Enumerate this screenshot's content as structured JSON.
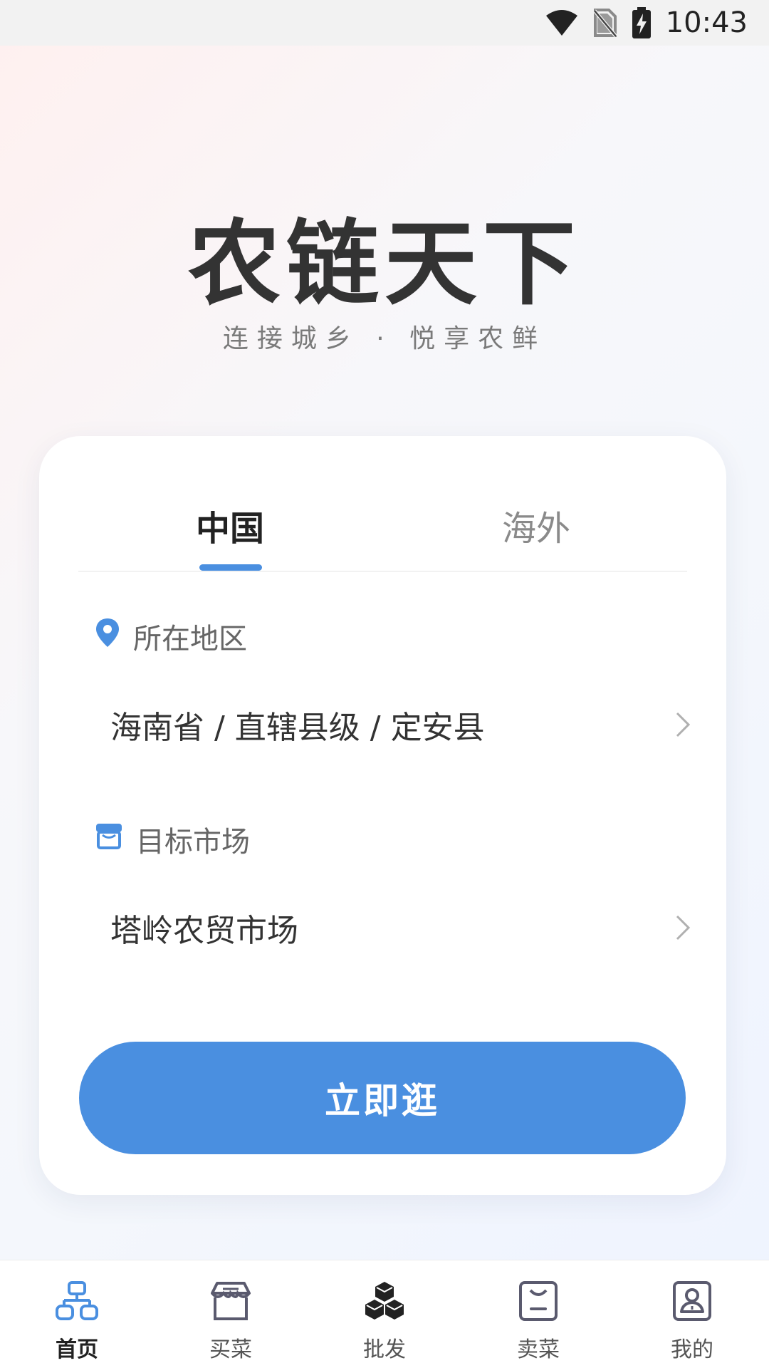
{
  "status_bar": {
    "time": "10:43",
    "icons": [
      "wifi-icon",
      "no-sim-icon",
      "battery-charging-icon"
    ]
  },
  "hero": {
    "title": "农链天下",
    "subtitle": "连接城乡 · 悦享农鲜"
  },
  "tabs": [
    {
      "label": "中国",
      "active": true
    },
    {
      "label": "海外",
      "active": false
    }
  ],
  "region": {
    "label": "所在地区",
    "icon": "location-pin-icon",
    "value": "海南省 / 直辖县级 / 定安县"
  },
  "market": {
    "label": "目标市场",
    "icon": "store-icon",
    "value": "塔岭农贸市场"
  },
  "action": {
    "label": "立即逛"
  },
  "bottom_nav": [
    {
      "label": "首页",
      "icon": "home-network-icon",
      "active": true
    },
    {
      "label": "买菜",
      "icon": "shop-icon",
      "active": false
    },
    {
      "label": "批发",
      "icon": "wholesale-boxes-icon",
      "active": false
    },
    {
      "label": "卖菜",
      "icon": "sell-bag-icon",
      "active": false
    },
    {
      "label": "我的",
      "icon": "profile-icon",
      "active": false
    }
  ],
  "colors": {
    "accent": "#4a8fe0",
    "title": "#333333",
    "muted": "#8a8a8a"
  }
}
